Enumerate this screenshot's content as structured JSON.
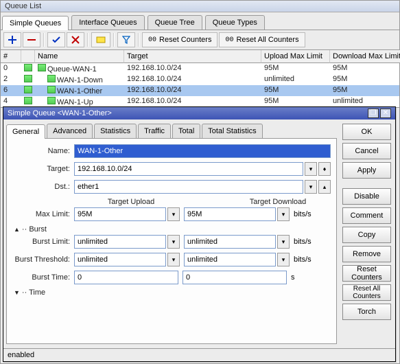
{
  "listWindow": {
    "title": "Queue List",
    "tabs": [
      "Simple Queues",
      "Interface Queues",
      "Queue Tree",
      "Queue Types"
    ],
    "activeTab": 0,
    "toolbar": {
      "resetCounters": "Reset Counters",
      "resetAllCounters": "Reset All Counters"
    },
    "columns": [
      "#",
      "",
      "Name",
      "Target",
      "Upload Max Limit",
      "Download Max Limit"
    ],
    "rows": [
      {
        "num": "0",
        "name": "Queue-WAN-1",
        "target": "192.168.10.0/24",
        "up": "95M",
        "down": "95M"
      },
      {
        "num": "2",
        "name": "WAN-1-Down",
        "target": "192.168.10.0/24",
        "up": "unlimited",
        "down": "95M"
      },
      {
        "num": "6",
        "name": "WAN-1-Other",
        "target": "192.168.10.0/24",
        "up": "95M",
        "down": "95M"
      },
      {
        "num": "4",
        "name": "WAN-1-Up",
        "target": "192.168.10.0/24",
        "up": "95M",
        "down": "unlimited"
      }
    ],
    "selectedRow": 2
  },
  "dialog": {
    "title": "Simple Queue <WAN-1-Other>",
    "tabs": [
      "General",
      "Advanced",
      "Statistics",
      "Traffic",
      "Total",
      "Total Statistics"
    ],
    "activeTab": 0,
    "labels": {
      "name": "Name:",
      "target": "Target:",
      "dst": "Dst.:",
      "targetUpload": "Target Upload",
      "targetDownload": "Target Download",
      "maxLimit": "Max Limit:",
      "burst": "Burst",
      "burstLimit": "Burst Limit:",
      "burstThreshold": "Burst Threshold:",
      "burstTime": "Burst Time:",
      "time": "Time",
      "bits": "bits/s",
      "sec": "s"
    },
    "values": {
      "name": "WAN-1-Other",
      "target": "192.168.10.0/24",
      "dst": "ether1",
      "maxUp": "95M",
      "maxDown": "95M",
      "burstLimitUp": "unlimited",
      "burstLimitDown": "unlimited",
      "burstThreshUp": "unlimited",
      "burstThreshDown": "unlimited",
      "burstTimeUp": "0",
      "burstTimeDown": "0"
    },
    "buttons": {
      "ok": "OK",
      "cancel": "Cancel",
      "apply": "Apply",
      "disable": "Disable",
      "comment": "Comment",
      "copy": "Copy",
      "remove": "Remove",
      "resetCounters": "Reset Counters",
      "resetAllCounters": "Reset All Counters",
      "torch": "Torch"
    },
    "status": "enabled"
  }
}
